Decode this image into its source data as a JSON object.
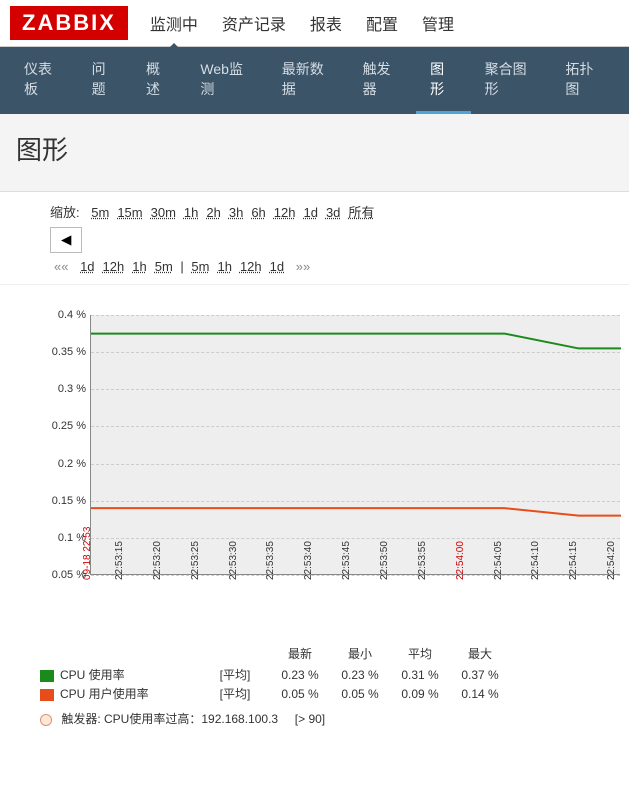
{
  "logo": "ZABBIX",
  "top_menu": {
    "items": [
      "监测中",
      "资产记录",
      "报表",
      "配置",
      "管理"
    ],
    "active": 0
  },
  "sub_nav": {
    "items": [
      "仪表板",
      "问题",
      "概述",
      "Web监测",
      "最新数据",
      "触发器",
      "图形",
      "聚合图形",
      "拓扑图"
    ],
    "active": 6
  },
  "page_title": "图形",
  "filter": {
    "zoom_label": "缩放:",
    "zoom_options": [
      "5m",
      "15m",
      "30m",
      "1h",
      "2h",
      "3h",
      "6h",
      "12h",
      "1d",
      "3d",
      "所有"
    ],
    "ctrl_prev": "◀",
    "nav_left_arrows": "«« ",
    "nav_left": [
      "1d",
      "12h",
      "1h",
      "5m"
    ],
    "nav_sep": " | ",
    "nav_right": [
      "5m",
      "1h",
      "12h",
      "1d"
    ],
    "nav_right_arrows": " »»"
  },
  "chart_data": {
    "type": "line",
    "ylim": [
      0.05,
      0.4
    ],
    "yticks": [
      0.05,
      0.1,
      0.15,
      0.2,
      0.25,
      0.3,
      0.35,
      0.4
    ],
    "yticklabels": [
      "0.05 %",
      "0.1 %",
      "0.15 %",
      "0.2 %",
      "0.25 %",
      "0.3 %",
      "0.35 %",
      "0.4 %"
    ],
    "x_start_label": "09-18 22:53",
    "x_start_class": "red",
    "xticks": [
      "22:53:15",
      "22:53:20",
      "22:53:25",
      "22:53:30",
      "22:53:35",
      "22:53:40",
      "22:53:45",
      "22:53:50",
      "22:53:55",
      "22:54:00",
      "22:54:05",
      "22:54:10",
      "22:54:15",
      "22:54:20"
    ],
    "x_red_index": 9,
    "series": [
      {
        "name": "CPU 使用率",
        "color": "#1a8a1a",
        "value_start": 0.375,
        "value_end": 0.355
      },
      {
        "name": "CPU 用户使用率",
        "color": "#e64d1a",
        "value_start": 0.14,
        "value_end": 0.13
      }
    ]
  },
  "legend": {
    "headers": [
      "最新",
      "最小",
      "平均",
      "最大"
    ],
    "rows": [
      {
        "swatch": "#1a8a1a",
        "name": "CPU 使用率",
        "agg": "[平均]",
        "vals": [
          "0.23 %",
          "0.23 %",
          "0.31 %",
          "0.37 %"
        ]
      },
      {
        "swatch": "#e64d1a",
        "name": "CPU 用户使用率",
        "agg": "[平均]",
        "vals": [
          "0.05 %",
          "0.05 %",
          "0.09 %",
          "0.14 %"
        ]
      }
    ],
    "trigger_label": "触发器: CPU使用率过高：192.168.100.3",
    "trigger_cond": "[> 90]"
  }
}
